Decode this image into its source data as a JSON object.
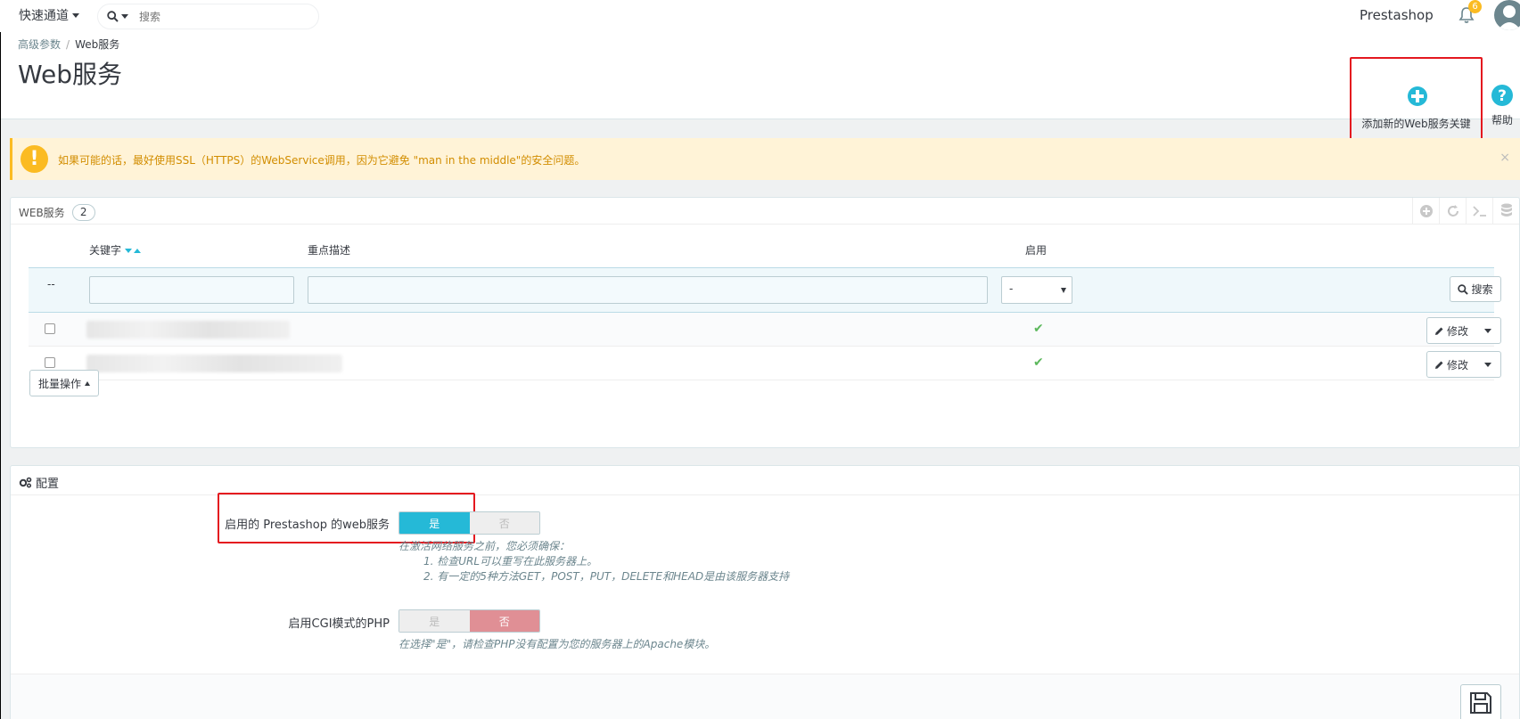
{
  "topnav": {
    "quick_access": "快速通道",
    "search_placeholder": "搜索",
    "shop_name": "Prestashop",
    "notification_count": "6"
  },
  "breadcrumb": {
    "parent": "高级参数",
    "separator": "/",
    "current": "Web服务"
  },
  "page_title": "Web服务",
  "toolbar": {
    "add_label": "添加新的Web服务关键",
    "help_label": "帮助"
  },
  "alert": {
    "text": "如果可能的话，最好使用SSL（HTTPS）的WebService调用，因为它避免 \"man in the middle\"的安全问题。",
    "close": "×"
  },
  "list_panel": {
    "title": "WEB服务",
    "count": "2",
    "columns": [
      "关键字",
      "重点描述",
      "启用"
    ],
    "filter_dash": "--",
    "filter_select_value": "-",
    "search_button": "搜索",
    "rows": [
      {
        "key": "XXXXXXXXXXXXXXXXXXXXXXXXXXXXXXXX",
        "enabled": "✔",
        "action": "修改"
      },
      {
        "key": "XXXXXXXXXXXXXXXXXXXXXXXXXXXXXXXXXXXXXXXX",
        "enabled": "✔",
        "action": "修改"
      }
    ],
    "bulk_actions": "批量操作"
  },
  "config_panel": {
    "title": "配置",
    "field1": {
      "label": "启用的 Prestashop 的web服务",
      "yes": "是",
      "no": "否",
      "selected": "yes",
      "help_lines": [
        "在激活网络服务之前，您必须确保：",
        "1. 检查URL可以重写在此服务器上。",
        "2. 有一定的5种方法GET，POST，PUT，DELETE和HEAD是由该服务器支持"
      ]
    },
    "field2": {
      "label": "启用CGI模式的PHP",
      "yes": "是",
      "no": "否",
      "selected": "no",
      "help": "在选择\"是\"，请检查PHP没有配置为您的服务器上的Apache模块。"
    }
  },
  "colors": {
    "accent": "#25b9d7",
    "warning": "#fbbb22",
    "danger": "#e08f95",
    "highlight": "#e4181f",
    "success": "#5cb85c"
  }
}
